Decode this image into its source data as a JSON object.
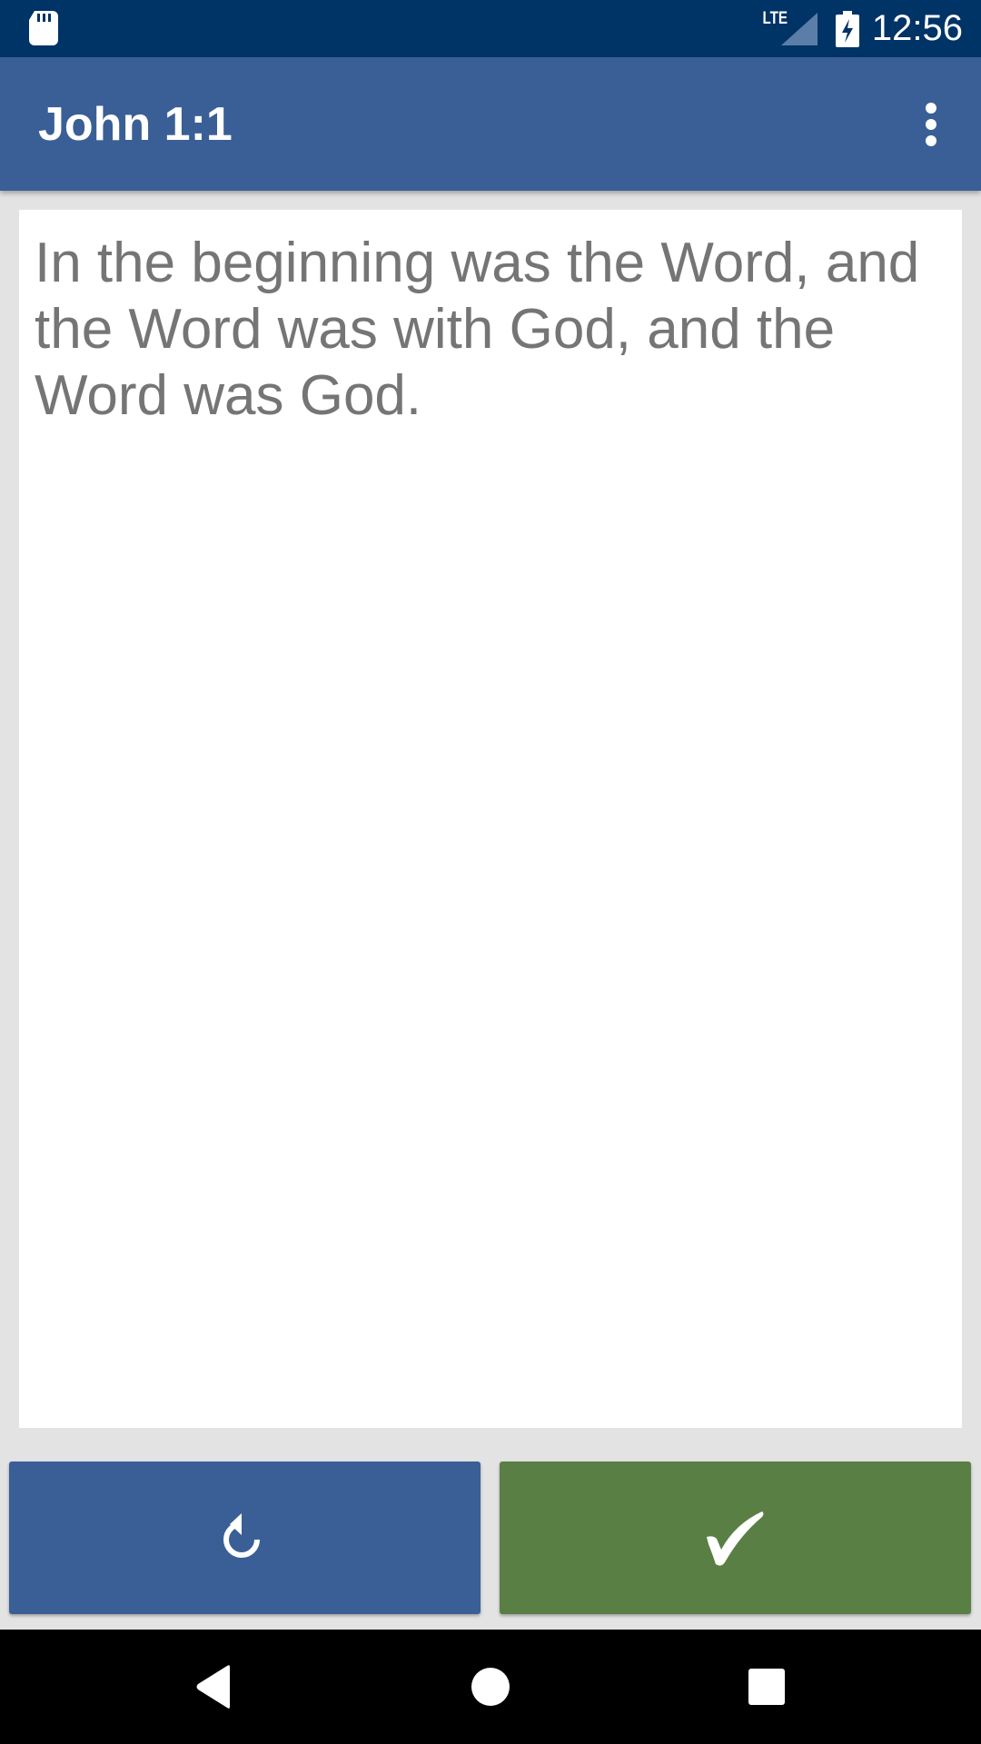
{
  "status_bar": {
    "network_label": "LTE",
    "time": "12:56",
    "icons": [
      "sd-card-icon",
      "signal-icon",
      "battery-charging-icon"
    ]
  },
  "app_bar": {
    "title": "John 1:1",
    "overflow_icon": "more-vert-icon"
  },
  "content": {
    "verse_text": "In the beginning was the Word, and the Word was with God, and the Word was God."
  },
  "actions": {
    "reset_icon": "replay-icon",
    "check_icon": "checkmark-icon",
    "reset_color": "#3a5f96",
    "check_color": "#5a7f44"
  },
  "nav_bar": {
    "icons": [
      "back-icon",
      "home-icon",
      "recents-icon"
    ]
  },
  "colors": {
    "status_bar": "#003366",
    "app_bar": "#3a5f96",
    "background": "#e3e3e3",
    "text": "#757575"
  }
}
